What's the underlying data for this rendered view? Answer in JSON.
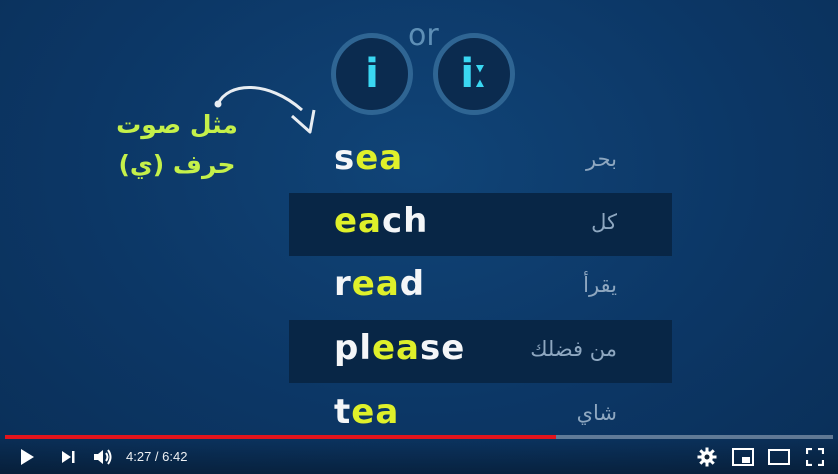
{
  "player": {
    "symbols": {
      "or": "or",
      "short": "i",
      "long": "iː"
    },
    "note": {
      "line1": "مثل صوت",
      "line2": "حرف (ي)"
    },
    "words": [
      {
        "parts": [
          {
            "t": "s",
            "h": false
          },
          {
            "t": "ea",
            "h": true
          }
        ],
        "arabic": "بحر",
        "dark": false
      },
      {
        "parts": [
          {
            "t": "ea",
            "h": true
          },
          {
            "t": "ch",
            "h": false
          }
        ],
        "arabic": "كل",
        "dark": true
      },
      {
        "parts": [
          {
            "t": "r",
            "h": false
          },
          {
            "t": "ea",
            "h": true
          },
          {
            "t": "d",
            "h": false
          }
        ],
        "arabic": "يقرأ",
        "dark": false
      },
      {
        "parts": [
          {
            "t": "pl",
            "h": false
          },
          {
            "t": "ea",
            "h": true
          },
          {
            "t": "se",
            "h": false
          }
        ],
        "arabic": "من فضلك",
        "dark": true
      },
      {
        "parts": [
          {
            "t": "t",
            "h": false
          },
          {
            "t": "ea",
            "h": true
          }
        ],
        "arabic": "شاي",
        "dark": false
      }
    ],
    "progress": 0.666,
    "time": {
      "current": "4:27",
      "total": "6:42",
      "display": "4:27 / 6:42"
    },
    "colors": {
      "highlight": "#dff02a",
      "note": "#c5f04a",
      "symbol": "#3ad7f2",
      "progress": "#e3141c"
    }
  }
}
